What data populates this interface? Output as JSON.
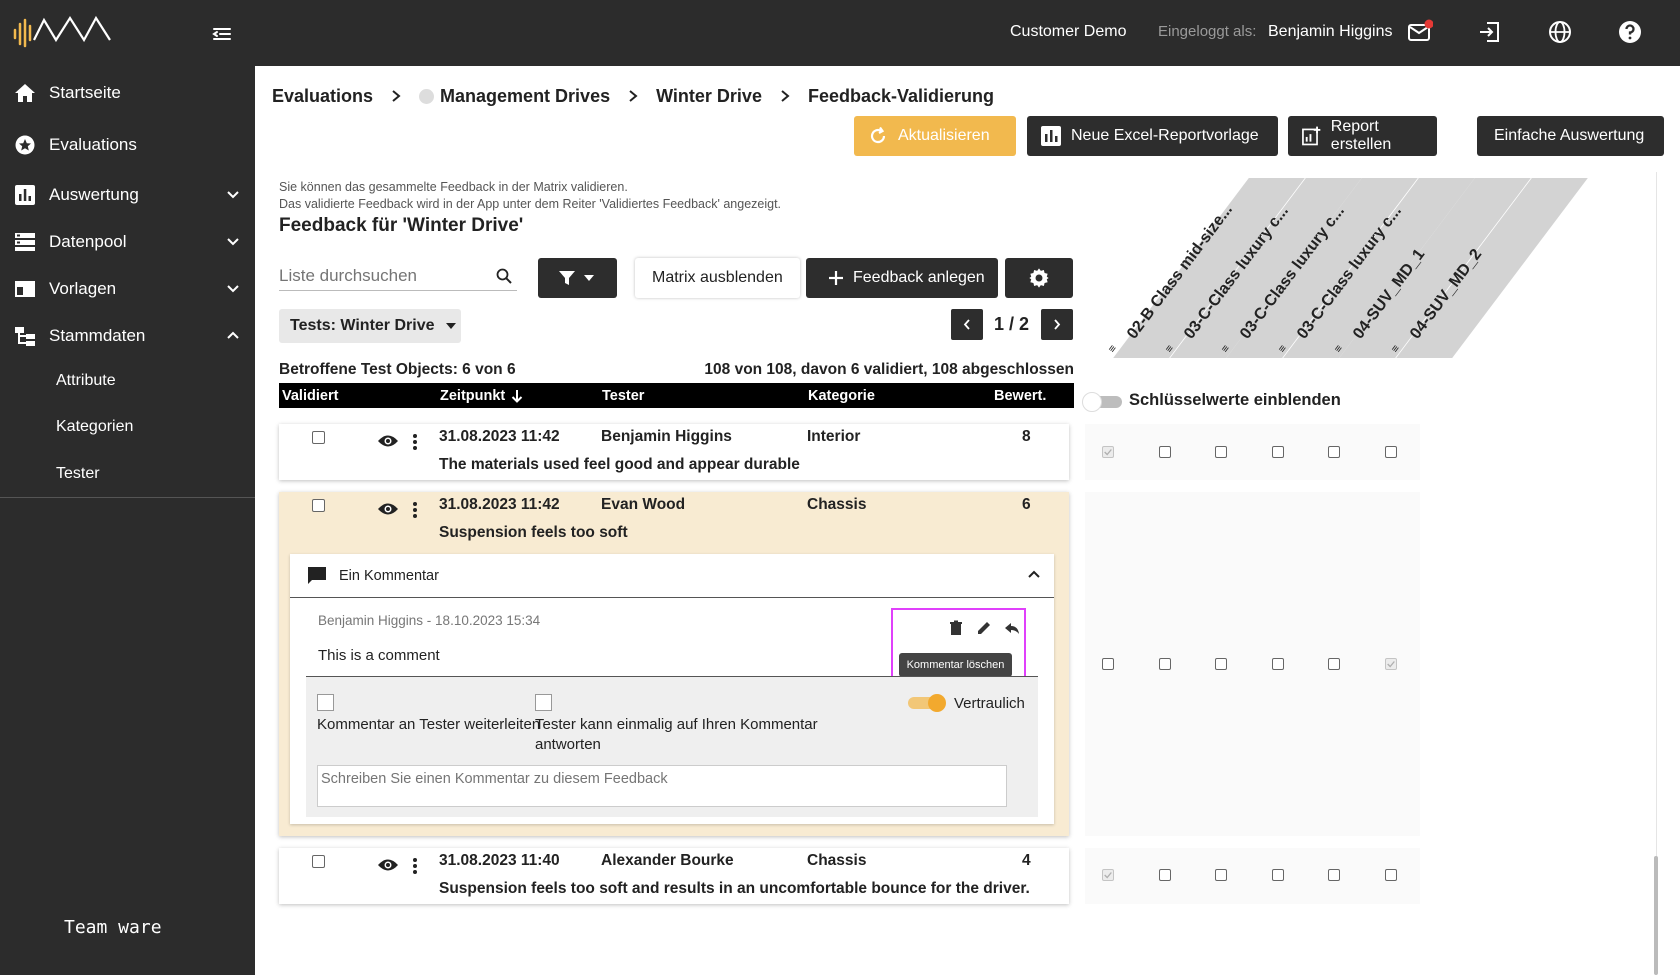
{
  "sidebar": {
    "items": [
      {
        "label": "Startseite",
        "icon": "home-icon"
      },
      {
        "label": "Evaluations",
        "icon": "star-badge-icon"
      },
      {
        "label": "Auswertung",
        "icon": "bar-chart-icon"
      },
      {
        "label": "Datenpool",
        "icon": "database-list-icon"
      },
      {
        "label": "Vorlagen",
        "icon": "template-icon"
      },
      {
        "label": "Stammdaten",
        "icon": "hierarchy-icon"
      }
    ],
    "subitems": [
      "Attribute",
      "Kategorien",
      "Tester"
    ],
    "brand": "Team ware"
  },
  "topbar": {
    "customer": "Customer Demo",
    "logged_in_label": "Eingeloggt als:",
    "user": "Benjamin Higgins"
  },
  "breadcrumb": [
    "Evaluations",
    "Management Drives",
    "Winter Drive",
    "Feedback-Validierung"
  ],
  "toolbar": {
    "refresh": "Aktualisieren",
    "excel": "Neue Excel-Reportvorlage",
    "report": "Report erstellen",
    "simple": "Einfache Auswertung"
  },
  "info": {
    "line1": "Sie können das gesammelte Feedback in der Matrix validieren.",
    "line2": "Das validierte Feedback wird in der App unter dem Reiter 'Validiertes Feedback' angezeigt.",
    "title": "Feedback für 'Winter Drive'"
  },
  "controls": {
    "search_placeholder": "Liste durchsuchen",
    "hide_matrix": "Matrix ausblenden",
    "add_feedback": "Feedback anlegen",
    "tests_filter": "Tests: Winter Drive",
    "page": "1 / 2"
  },
  "summary": {
    "affected": "Betroffene Test Objects: 6 von 6",
    "counts": "108 von 108, davon 6 validiert, 108 abgeschlossen"
  },
  "table": {
    "headers": [
      "Validiert",
      "Zeitpunkt",
      "Tester",
      "Kategorie",
      "Bewert."
    ],
    "rows": [
      {
        "time": "31.08.2023 11:42",
        "tester": "Benjamin Higgins",
        "category": "Interior",
        "rating": "8",
        "text": "The materials used feel good and appear durable"
      },
      {
        "time": "31.08.2023 11:42",
        "tester": "Evan Wood",
        "category": "Chassis",
        "rating": "6",
        "text": "Suspension feels too soft"
      },
      {
        "time": "31.08.2023 11:40",
        "tester": "Alexander Bourke",
        "category": "Chassis",
        "rating": "4",
        "text": "Suspension feels too soft and results in an uncomfortable bounce for the driver."
      }
    ]
  },
  "comments": {
    "header": "Ein Kommentar",
    "meta": "Benjamin Higgins - 18.10.2023 15:34",
    "text": "This is a comment",
    "tooltip": "Kommentar löschen",
    "forward_label": "Kommentar an Tester weiterleiten",
    "reply_label_1": "Tester kann einmalig auf Ihren Kommentar",
    "reply_label_2": "antworten",
    "confidential": "Vertraulich",
    "confidential_on": true,
    "input_placeholder": "Schreiben Sie einen Kommentar zu diesem Feedback"
  },
  "matrix": {
    "columns": [
      "02-B Class mid-size...",
      "03-C-Class luxury c...",
      "03-C-Class luxury c...",
      "03-C-Class luxury c...",
      "04-SUV_MD_1",
      "04-SUV_MD_2"
    ],
    "key_toggle": "Schlüsselwerte einblenden",
    "rows": [
      [
        true,
        false,
        false,
        false,
        false,
        false
      ],
      [
        false,
        false,
        false,
        false,
        false,
        true
      ],
      [
        true,
        false,
        false,
        false,
        false,
        false
      ]
    ]
  },
  "colors": {
    "sidebar_bg": "#2c2c2c",
    "accent_orange": "#f2b94e",
    "highlight_row": "#f8ebd2",
    "tooltip_border": "#e040fb"
  }
}
